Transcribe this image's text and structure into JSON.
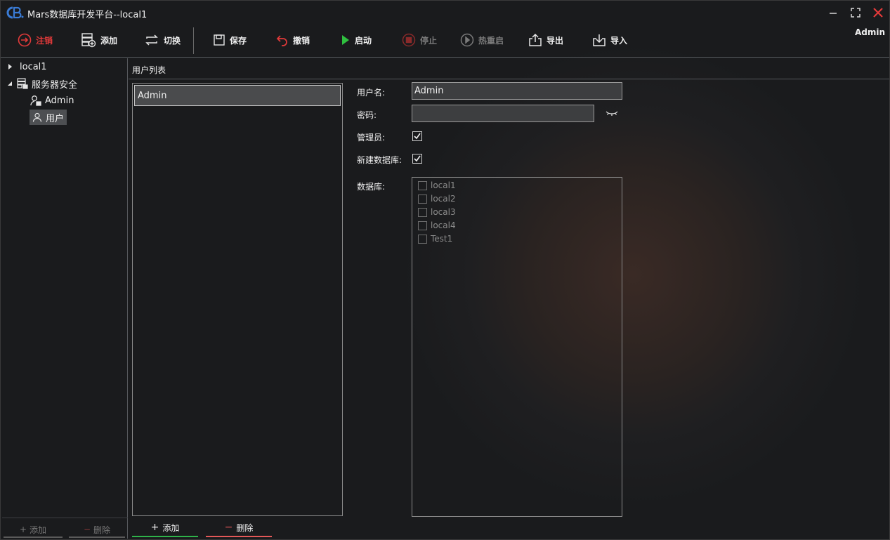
{
  "window": {
    "title": "Mars数据库开发平台--local1",
    "current_user": "Admin",
    "colors": {
      "accent_red": "#e23a3a",
      "accent_green": "#2fb34a",
      "disabled": "#7a7a7a"
    }
  },
  "toolbar": {
    "logout_label": "注销",
    "add_label": "添加",
    "switch_label": "切换",
    "save_label": "保存",
    "undo_label": "撤销",
    "start_label": "启动",
    "stop_label": "停止",
    "hot_restart_label": "热重启",
    "export_label": "导出",
    "import_label": "导入"
  },
  "tree": {
    "items": [
      {
        "label": "local1"
      },
      {
        "label": "服务器安全"
      },
      {
        "label": "Admin"
      },
      {
        "label": "用户"
      }
    ],
    "add_label": "添加",
    "delete_label": "删除"
  },
  "main": {
    "title": "用户列表",
    "users": [
      "Admin"
    ],
    "add_label": "添加",
    "delete_label": "删除"
  },
  "form": {
    "username_label": "用户名:",
    "username_value": "Admin",
    "password_label": "密码:",
    "password_value": "",
    "admin_label": "管理员:",
    "admin_checked": true,
    "create_db_label": "新建数据库:",
    "create_db_checked": true,
    "databases_label": "数据库:",
    "databases": [
      "local1",
      "local2",
      "local3",
      "local4",
      "Test1"
    ]
  }
}
